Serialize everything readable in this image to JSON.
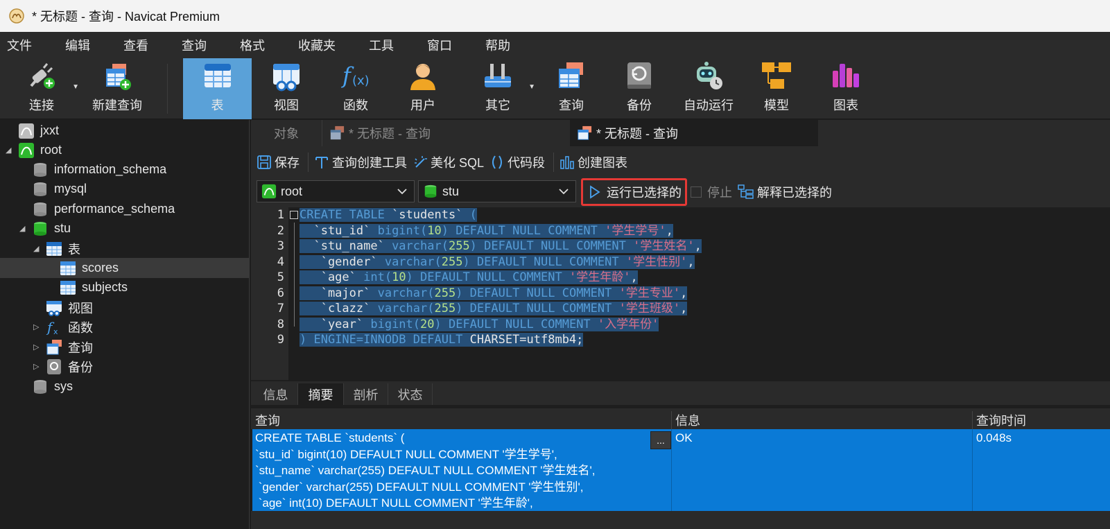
{
  "window": {
    "title": "* 无标题 - 查询 - Navicat Premium"
  },
  "menu": [
    "文件",
    "编辑",
    "查看",
    "查询",
    "格式",
    "收藏夹",
    "工具",
    "窗口",
    "帮助"
  ],
  "toolbar": {
    "connect": "连接",
    "new_query": "新建查询",
    "table": "表",
    "view": "视图",
    "function": "函数",
    "user": "用户",
    "other": "其它",
    "query": "查询",
    "backup": "备份",
    "automation": "自动运行",
    "model": "模型",
    "chart": "图表"
  },
  "tree": {
    "jxxt": "jxxt",
    "root": "root",
    "information_schema": "information_schema",
    "mysql": "mysql",
    "performance_schema": "performance_schema",
    "stu": "stu",
    "tables": "表",
    "scores": "scores",
    "subjects": "subjects",
    "views": "视图",
    "functions": "函数",
    "queries": "查询",
    "backups": "备份",
    "sys": "sys"
  },
  "tabs": {
    "objects": "对象",
    "tab1": "* 无标题 - 查询",
    "tab2": "* 无标题 - 查询"
  },
  "query_toolbar": {
    "save": "保存",
    "builder": "查询创建工具",
    "beautify": "美化 SQL",
    "snippet": "代码段",
    "create_chart": "创建图表"
  },
  "connection": {
    "connection_value": "root",
    "database_value": "stu",
    "run_selected": "运行已选择的",
    "stop": "停止",
    "explain_selected": "解释已选择的"
  },
  "editor": {
    "line_numbers": [
      "1",
      "2",
      "3",
      "4",
      "5",
      "6",
      "7",
      "8",
      "9"
    ],
    "lines": [
      [
        [
          "kw",
          "CREATE TABLE "
        ],
        [
          "pl",
          "`students`"
        ],
        [
          "kw",
          " ("
        ]
      ],
      [
        [
          "pl",
          "  `stu_id` "
        ],
        [
          "kw",
          "bigint("
        ],
        [
          "num",
          "10"
        ],
        [
          "kw",
          ") DEFAULT NULL COMMENT "
        ],
        [
          "str",
          "'学生学号'"
        ],
        [
          "pl",
          ","
        ]
      ],
      [
        [
          "pl",
          "  `stu_name` "
        ],
        [
          "kw",
          "varchar("
        ],
        [
          "num",
          "255"
        ],
        [
          "kw",
          ") DEFAULT NULL COMMENT "
        ],
        [
          "str",
          "'学生姓名'"
        ],
        [
          "pl",
          ","
        ]
      ],
      [
        [
          "pl",
          "   `gender` "
        ],
        [
          "kw",
          "varchar("
        ],
        [
          "num",
          "255"
        ],
        [
          "kw",
          ") DEFAULT NULL COMMENT "
        ],
        [
          "str",
          "'学生性别'"
        ],
        [
          "pl",
          ","
        ]
      ],
      [
        [
          "pl",
          "   `age` "
        ],
        [
          "kw",
          "int("
        ],
        [
          "num",
          "10"
        ],
        [
          "kw",
          ") DEFAULT NULL COMMENT "
        ],
        [
          "str",
          "'学生年龄'"
        ],
        [
          "pl",
          ","
        ]
      ],
      [
        [
          "pl",
          "   `major` "
        ],
        [
          "kw",
          "varchar("
        ],
        [
          "num",
          "255"
        ],
        [
          "kw",
          ") DEFAULT NULL COMMENT "
        ],
        [
          "str",
          "'学生专业'"
        ],
        [
          "pl",
          ","
        ]
      ],
      [
        [
          "pl",
          "   `clazz` "
        ],
        [
          "kw",
          "varchar("
        ],
        [
          "num",
          "255"
        ],
        [
          "kw",
          ") DEFAULT NULL COMMENT "
        ],
        [
          "str",
          "'学生班级'"
        ],
        [
          "pl",
          ","
        ]
      ],
      [
        [
          "pl",
          "   `year` "
        ],
        [
          "kw",
          "bigint("
        ],
        [
          "num",
          "20"
        ],
        [
          "kw",
          ") DEFAULT NULL COMMENT "
        ],
        [
          "str",
          "'入学年份'"
        ]
      ],
      [
        [
          "kw",
          ") ENGINE=INNODB DEFAULT "
        ],
        [
          "pl",
          "CHARSET=utf8mb4;"
        ]
      ]
    ]
  },
  "result_tabs": [
    "信息",
    "摘要",
    "剖析",
    "状态"
  ],
  "result_table": {
    "headers": [
      "查询",
      "信息",
      "查询时间"
    ],
    "row": {
      "query_lines": [
        "CREATE TABLE `students` (",
        "`stu_id` bigint(10) DEFAULT NULL COMMENT '学生学号',",
        "`stu_name` varchar(255) DEFAULT NULL COMMENT '学生姓名',",
        " `gender` varchar(255) DEFAULT NULL COMMENT '学生性别',",
        " `age` int(10) DEFAULT NULL COMMENT '学生年龄',"
      ],
      "more": "...",
      "info": "OK",
      "time": "0.048s"
    }
  }
}
